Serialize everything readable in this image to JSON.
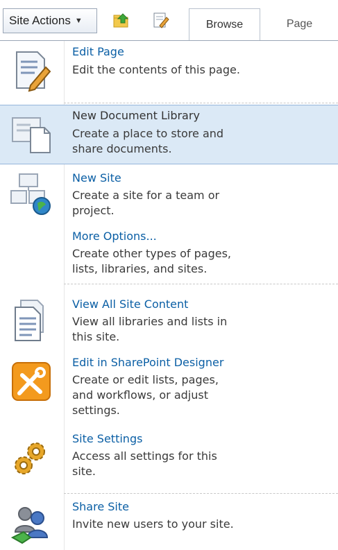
{
  "ribbon": {
    "site_actions_label": "Site Actions",
    "site_actions_caret": "▼",
    "icons": [
      "navigate-up-icon",
      "edit-icon"
    ],
    "tabs": [
      "Browse",
      "Page"
    ]
  },
  "menu": {
    "items": [
      {
        "title": "Edit Page",
        "desc": [
          "Edit the contents of this page."
        ],
        "icon": "edit-page-icon"
      },
      {
        "title": "New Document Library",
        "desc": [
          "Create a place to store and",
          "share documents."
        ],
        "icon": "document-library-icon"
      },
      {
        "title": "New Site",
        "desc": [
          "Create a site for a team or",
          "project."
        ],
        "icon": "new-site-icon"
      },
      {
        "title": "More Options...",
        "desc": [
          "Create other types of pages,",
          "lists, libraries, and sites."
        ],
        "icon": ""
      },
      {
        "title": "View All Site Content",
        "desc": [
          "View all libraries and lists in",
          "this site."
        ],
        "icon": "site-content-icon"
      },
      {
        "title": "Edit in SharePoint Designer",
        "desc": [
          "Create or edit lists, pages,",
          "and workflows, or adjust",
          "settings."
        ],
        "icon": "sharepoint-designer-icon"
      },
      {
        "title": "Site Settings",
        "desc": [
          "Access all settings for this",
          "site."
        ],
        "icon": "gears-icon"
      },
      {
        "title": "Share Site",
        "desc": [
          "Invite new users to your site."
        ],
        "icon": "share-site-icon"
      }
    ]
  },
  "colors": {
    "link": "#0b5fa5",
    "highlight": "#dbe9f6",
    "text": "#3a3a3a"
  }
}
